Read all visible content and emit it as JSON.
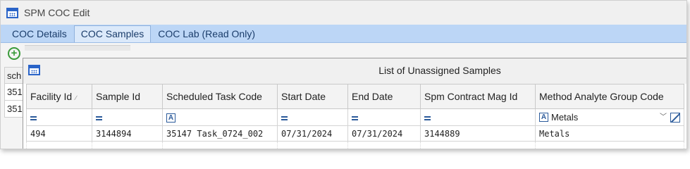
{
  "window": {
    "title": "SPM COC Edit"
  },
  "tabs": [
    {
      "label": "COC Details",
      "active": false
    },
    {
      "label": "COC Samples",
      "active": true
    },
    {
      "label": "COC Lab (Read Only)",
      "active": false
    }
  ],
  "behind_grid": {
    "header": "sch",
    "rows": [
      "351",
      "351"
    ]
  },
  "dialog": {
    "title": "List of Unassigned Samples",
    "columns": [
      {
        "label": "Facility Id",
        "sort": "ascending"
      },
      {
        "label": "Sample Id"
      },
      {
        "label": "Scheduled Task Code"
      },
      {
        "label": "Start Date"
      },
      {
        "label": "End Date"
      },
      {
        "label": "Spm Contract Mag Id"
      },
      {
        "label": "Method Analyte Group Code"
      }
    ],
    "filter_row": {
      "method_analyte_group_code": "Metals"
    },
    "rows": [
      [
        "494",
        "3144894",
        "35147 Task_0724_002",
        "07/31/2024",
        "07/31/2024",
        "3144889",
        "Metals"
      ]
    ]
  },
  "icons": {
    "app": "calendar-grid-icon",
    "add": "plus-circle-icon",
    "equals_filter": "equals-icon",
    "text_filter": "text-a-icon",
    "dropdown": "chevron-down-icon",
    "clear_filter": "clear-filter-icon"
  },
  "colors": {
    "tab_strip": "#bcd6f6",
    "accent": "#2a64c8",
    "add_green": "#3a9a3a"
  }
}
